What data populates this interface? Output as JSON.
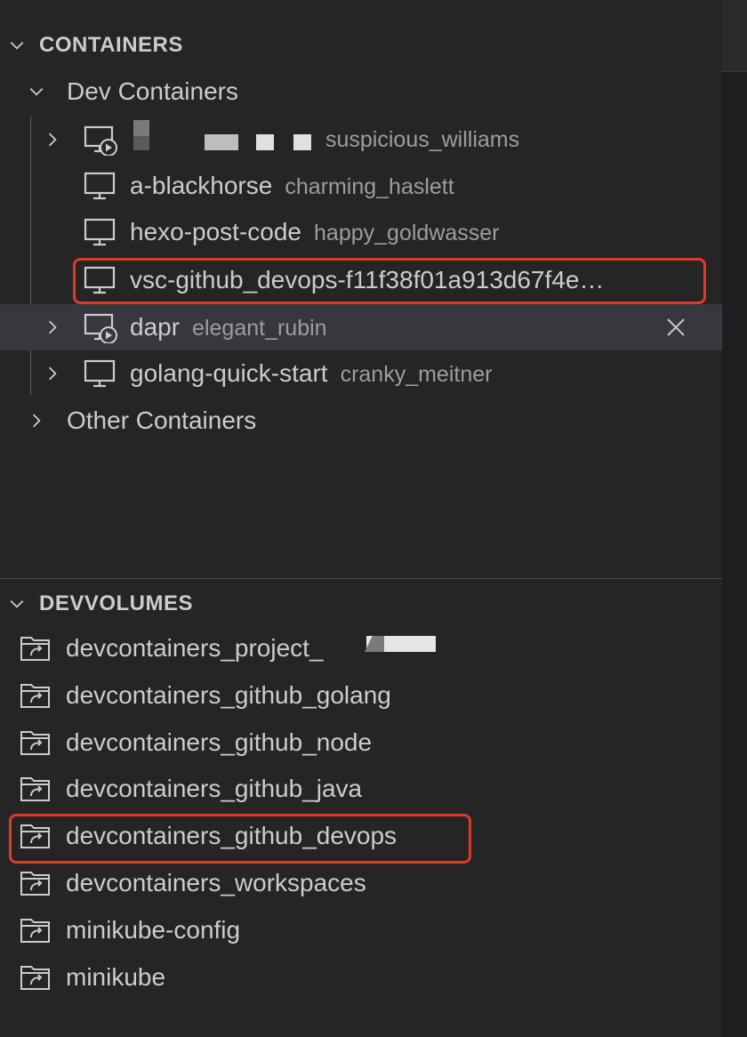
{
  "containers": {
    "header": "CONTAINERS",
    "dev_group": "Dev Containers",
    "items": [
      {
        "name": "",
        "desc": "suspicious_williams",
        "running": true,
        "expandable": true
      },
      {
        "name": "a-blackhorse",
        "desc": "charming_haslett",
        "running": false,
        "expandable": false
      },
      {
        "name": "hexo-post-code",
        "desc": "happy_goldwasser",
        "running": false,
        "expandable": false
      },
      {
        "name": "vsc-github_devops-f11f38f01a913d67f4e…",
        "desc": "",
        "running": false,
        "expandable": false
      },
      {
        "name": "dapr",
        "desc": "elegant_rubin",
        "running": true,
        "expandable": true
      },
      {
        "name": "golang-quick-start",
        "desc": "cranky_meitner",
        "running": false,
        "expandable": true
      }
    ],
    "other_group": "Other Containers"
  },
  "devvolumes": {
    "header": "DEVVOLUMES",
    "items": [
      "devcontainers_project_",
      "devcontainers_github_golang",
      "devcontainers_github_node",
      "devcontainers_github_java",
      "devcontainers_github_devops",
      "devcontainers_workspaces",
      "minikube-config",
      "minikube"
    ]
  },
  "icons": {
    "container": "monitor-icon",
    "running_container": "monitor-play-icon",
    "volume": "folder-link-icon",
    "chevron_down": "chevron-down-icon",
    "chevron_right": "chevron-right-icon",
    "remove": "close-icon"
  },
  "colors": {
    "background": "#252526",
    "selection": "#37373d",
    "highlight_box": "#e0392b",
    "text": "#cccccc",
    "description": "#9d9d9d"
  }
}
